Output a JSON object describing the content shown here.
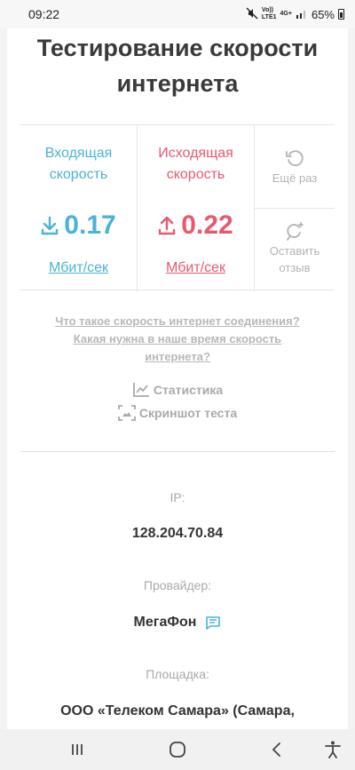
{
  "status": {
    "time": "09:22",
    "net_top": "Vo))",
    "net_bottom": "LTE1",
    "net_type": "4G+",
    "battery": "65%"
  },
  "page": {
    "title": "Тестирование скорости интернета"
  },
  "speed": {
    "download": {
      "label_line1": "Входящая",
      "label_line2": "скорость",
      "value": "0.17",
      "unit": "Мбит/сек",
      "color": "#4bb3d6"
    },
    "upload": {
      "label_line1": "Исходящая",
      "label_line2": "скорость",
      "value": "0.22",
      "unit": "Мбит/сек",
      "color": "#e8596d"
    },
    "retry_label": "Ещё раз",
    "review_line1": "Оставить",
    "review_line2": "отзыв"
  },
  "links": {
    "line1": "Что такое скорость интернет соединения?",
    "line2": "Какая нужна в наше время скорость интернета?"
  },
  "tools": {
    "stats": "Статистика",
    "screenshot": "Скриншот теста"
  },
  "info": {
    "ip_label": "IP:",
    "ip_value": "128.204.70.84",
    "provider_label": "Провайдер:",
    "provider_value": "МегаФон",
    "platform_label": "Площадка:",
    "platform_value": "ООО «Телеком Самара» (Самара,"
  },
  "icons": {
    "download": "download-icon",
    "upload": "upload-icon",
    "retry": "refresh-icon",
    "review": "feedback-icon",
    "stats": "chart-icon",
    "screenshot": "screenshot-icon",
    "chat": "chat-icon"
  }
}
